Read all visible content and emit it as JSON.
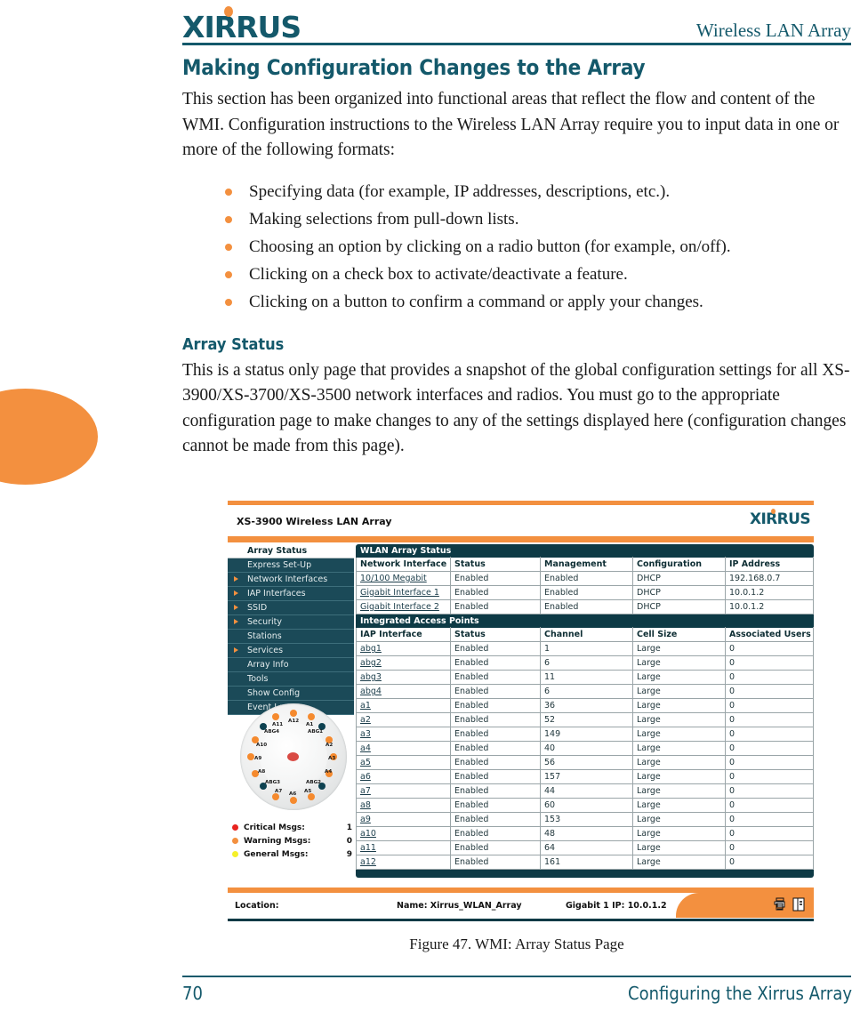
{
  "page": {
    "header_right": "Wireless LAN Array",
    "logo_text": "XIRRUS",
    "section_title": "Making Configuration Changes to the Array",
    "intro_paragraph": "This section has been organized into functional areas that reflect the flow and content of the WMI. Configuration instructions to the Wireless LAN Array require you to input data in one or more of the following formats:",
    "bullets": [
      "Specifying data (for example, IP addresses, descriptions, etc.).",
      "Making selections from pull-down lists.",
      "Choosing an option by clicking on a radio button (for example, on/off).",
      "Clicking on a check box to activate/deactivate a feature.",
      "Clicking on a button to confirm a command or apply your changes."
    ],
    "subsection_title": "Array Status",
    "subsection_paragraph": "This is a status only page that provides a snapshot of the global configuration settings for all XS-3900/XS-3700/XS-3500 network interfaces and radios. You must go to the appropriate configuration page to make changes to any of the settings displayed here (configuration changes cannot be made from this page).",
    "figure_caption": "Figure 47. WMI: Array Status Page",
    "footer_page_number": "70",
    "footer_chapter": "Configuring the Xirrus Array",
    "colors": {
      "brand_teal": "#14596b",
      "brand_orange": "#f3903f",
      "panel_dark": "#0d3a45",
      "sidebar": "#1b4a58"
    }
  },
  "wmi": {
    "title": "XS-3900 Wireless LAN Array",
    "logo_text": "XIRRUS",
    "sidebar": {
      "header": "Array Status",
      "items": [
        {
          "label": "Express Set-Up",
          "expandable": false
        },
        {
          "label": "Network Interfaces",
          "expandable": true
        },
        {
          "label": "IAP Interfaces",
          "expandable": true
        },
        {
          "label": "SSID",
          "expandable": true
        },
        {
          "label": "Security",
          "expandable": true
        },
        {
          "label": "Stations",
          "expandable": false
        },
        {
          "label": "Services",
          "expandable": true
        },
        {
          "label": "Array Info",
          "expandable": false
        },
        {
          "label": "Tools",
          "expandable": false
        },
        {
          "label": "Show Config",
          "expandable": false
        },
        {
          "label": "Event Log",
          "expandable": false
        }
      ]
    },
    "panel_title": "WLAN Array Status",
    "network_table": {
      "columns": [
        "Network Interface",
        "Status",
        "Management",
        "Configuration",
        "IP Address"
      ],
      "rows": [
        [
          "10/100 Megabit",
          "Enabled",
          "Enabled",
          "DHCP",
          "192.168.0.7"
        ],
        [
          "Gigabit Interface 1",
          "Enabled",
          "Enabled",
          "DHCP",
          "10.0.1.2"
        ],
        [
          "Gigabit Interface 2",
          "Enabled",
          "Enabled",
          "DHCP",
          "10.0.1.2"
        ]
      ]
    },
    "iap_section_title": "Integrated Access Points",
    "iap_table": {
      "columns": [
        "IAP Interface",
        "Status",
        "Channel",
        "Cell Size",
        "Associated Users"
      ],
      "rows": [
        [
          "abg1",
          "Enabled",
          "1",
          "Large",
          "0"
        ],
        [
          "abg2",
          "Enabled",
          "6",
          "Large",
          "0"
        ],
        [
          "abg3",
          "Enabled",
          "11",
          "Large",
          "0"
        ],
        [
          "abg4",
          "Enabled",
          "6",
          "Large",
          "0"
        ],
        [
          "a1",
          "Enabled",
          "36",
          "Large",
          "0"
        ],
        [
          "a2",
          "Enabled",
          "52",
          "Large",
          "0"
        ],
        [
          "a3",
          "Enabled",
          "149",
          "Large",
          "0"
        ],
        [
          "a4",
          "Enabled",
          "40",
          "Large",
          "0"
        ],
        [
          "a5",
          "Enabled",
          "56",
          "Large",
          "0"
        ],
        [
          "a6",
          "Enabled",
          "157",
          "Large",
          "0"
        ],
        [
          "a7",
          "Enabled",
          "44",
          "Large",
          "0"
        ],
        [
          "a8",
          "Enabled",
          "60",
          "Large",
          "0"
        ],
        [
          "a9",
          "Enabled",
          "153",
          "Large",
          "0"
        ],
        [
          "a10",
          "Enabled",
          "48",
          "Large",
          "0"
        ],
        [
          "a11",
          "Enabled",
          "64",
          "Large",
          "0"
        ],
        [
          "a12",
          "Enabled",
          "161",
          "Large",
          "0"
        ]
      ]
    },
    "array_diagram": {
      "radios_a": [
        "A1",
        "A2",
        "A3",
        "A4",
        "A5",
        "A6",
        "A7",
        "A8",
        "A9",
        "A10",
        "A11",
        "A12"
      ],
      "radios_abg": [
        "ABG1",
        "ABG2",
        "ABG3",
        "ABG4"
      ],
      "color_a": "#f58a2e",
      "color_abg": "#0d4150",
      "color_center": "#d94a44"
    },
    "messages": [
      {
        "label": "Critical Msgs:",
        "value": "1",
        "color": "#e8231f"
      },
      {
        "label": "Warning Msgs:",
        "value": "0",
        "color": "#f3903f"
      },
      {
        "label": "General Msgs:",
        "value": "9",
        "color": "#f5f02a"
      }
    ],
    "footer": {
      "location": "Location:",
      "name": "Name: Xirrus_WLAN_Array",
      "gigabit_ip": "Gigabit 1 IP: 10.0.1.2",
      "icons": [
        "printer-icon",
        "help-book-icon"
      ]
    }
  }
}
